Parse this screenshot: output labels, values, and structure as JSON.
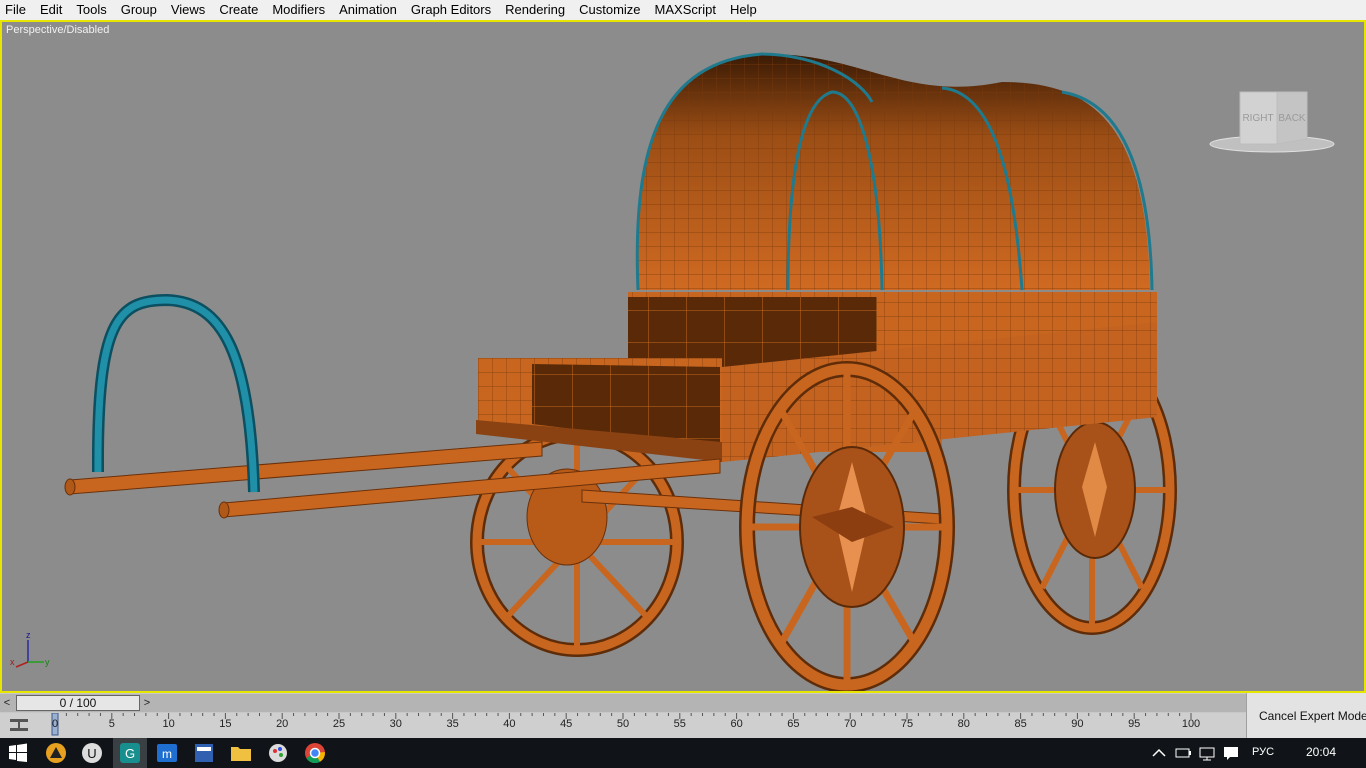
{
  "menu": [
    "File",
    "Edit",
    "Tools",
    "Group",
    "Views",
    "Create",
    "Modifiers",
    "Animation",
    "Graph Editors",
    "Rendering",
    "Customize",
    "MAXScript",
    "Help"
  ],
  "viewport": {
    "label": "Perspective/Disabled",
    "viewcube": {
      "face_right": "RIGHT",
      "face_back": "BACK"
    },
    "axis": {
      "z": "z",
      "x": "x",
      "y": "y"
    }
  },
  "timeline": {
    "frame_display": "0 / 100",
    "prev_arrow": "<",
    "next_arrow": ">",
    "ticks": [
      "0",
      "5",
      "10",
      "15",
      "20",
      "25",
      "30",
      "35",
      "40",
      "45",
      "50",
      "55",
      "60",
      "65",
      "70",
      "75",
      "80",
      "85",
      "90",
      "95",
      "100"
    ]
  },
  "expert_mode": {
    "label": "Cancel Expert Mode"
  },
  "taskbar": {
    "apps": [
      "start",
      "3ds-max-alt",
      "unreal",
      "3ds-max",
      "mail",
      "todo-app",
      "file-explorer",
      "paint",
      "chrome"
    ],
    "language": "РУС",
    "time": "20:04"
  },
  "colors": {
    "viewport_bg": "#8c8c8c",
    "wagon_orange": "#c8661f",
    "wagon_dark": "#5a2a08",
    "arch_blue": "#1f90a8",
    "viewport_border": "#e6e600"
  }
}
